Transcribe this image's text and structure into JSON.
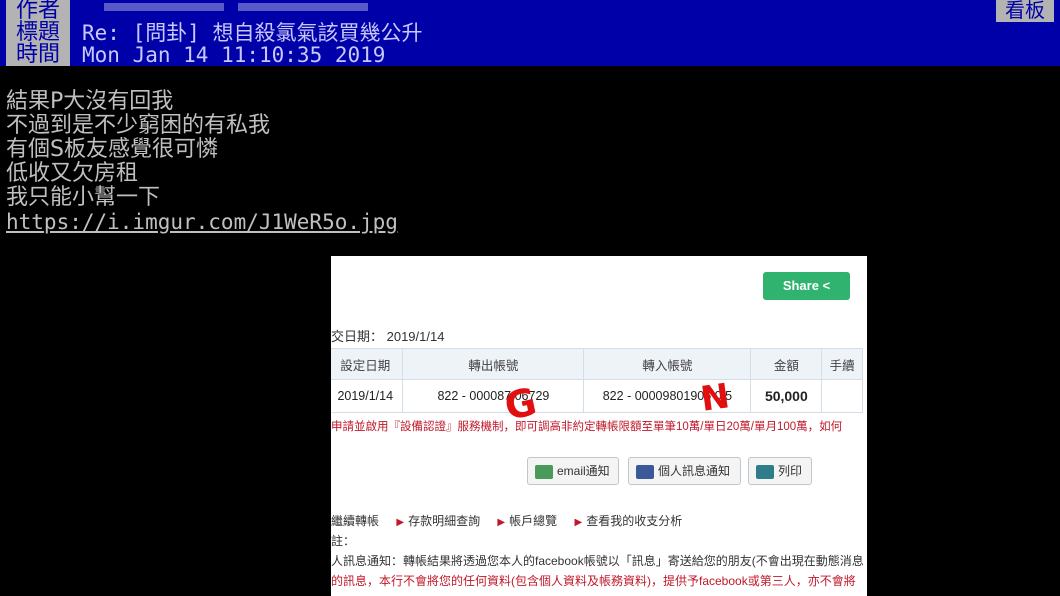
{
  "header": {
    "author_key": "作者",
    "author_value": "",
    "board_tag": "看板",
    "title_key": "標題",
    "title_value": "Re: [問卦] 想自殺氯氣該買幾公升",
    "time_key": "時間",
    "time_value": "Mon Jan 14 11:10:35 2019"
  },
  "post": {
    "lines": [
      "結果P大沒有回我",
      "不過到是不少窮困的有私我",
      "有個S板友感覺很可憐",
      "低收又欠房租",
      "我只能小幫一下"
    ],
    "link": "https://i.imgur.com/J1WeR5o.jpg"
  },
  "screenshot": {
    "share_label": "Share",
    "date_label": "交日期： 2019/1/14",
    "table": {
      "headers": [
        "設定日期",
        "轉出帳號",
        "轉入帳號",
        "金額",
        "手續"
      ],
      "row": [
        "2019/1/14",
        "822 - 000087 06729",
        "822 - 00009801905 0 5",
        "50,000",
        ""
      ]
    },
    "notice": "申請並啟用『設備認證』服務機制，即可調高非約定轉帳限額至單筆10萬/單日20萬/單月100萬，如何",
    "buttons": {
      "email": "email通知",
      "facebook": "個人訊息通知",
      "print": "列印"
    },
    "links": [
      "繼續轉帳",
      "存款明細查詢",
      "帳戶總覽",
      "查看我的收支分析"
    ],
    "note1": "註：",
    "note2": "人訊息通知：轉帳結果將透過您本人的facebook帳號以「訊息」寄送給您的朋友(不會出現在動態消息",
    "note3": "的訊息，本行不會將您的任何資料(包含個人資料及帳務資料)，提供予facebook或第三人，亦不會將",
    "marks": [
      "G",
      "N"
    ]
  },
  "colors": {
    "header_bg": "#0000a8",
    "header_key_bg": "#b3b3b3",
    "share_green": "#2fb36e",
    "amount_red": "#c0182a"
  }
}
